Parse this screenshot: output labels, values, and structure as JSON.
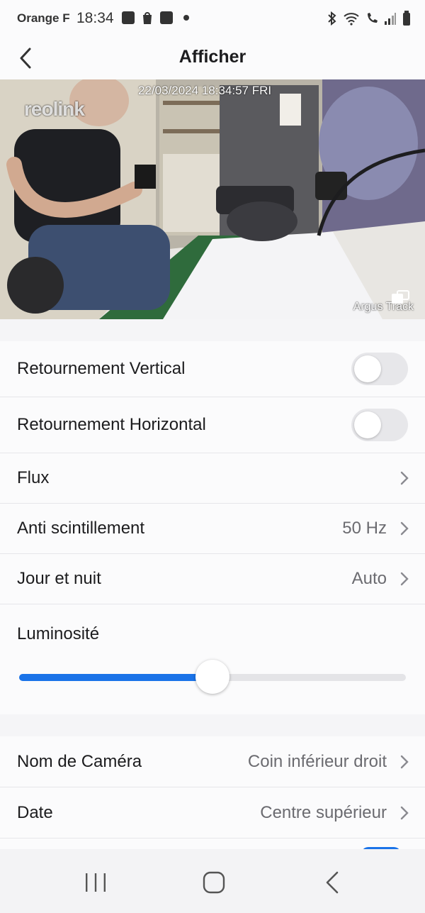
{
  "status_bar": {
    "carrier": "Orange F",
    "time": "18:34"
  },
  "header": {
    "title": "Afficher"
  },
  "preview": {
    "timestamp": "22/03/2024 18:34:57 FRI",
    "logo_text": "reolink",
    "camera_name": "Argus Track"
  },
  "settings": {
    "vertical_flip": {
      "label": "Retournement Vertical",
      "enabled": false
    },
    "horizontal_flip": {
      "label": "Retournement Horizontal",
      "enabled": false
    },
    "stream": {
      "label": "Flux"
    },
    "anti_flicker": {
      "label": "Anti scintillement",
      "value": "50 Hz"
    },
    "day_night": {
      "label": "Jour et nuit",
      "value": "Auto"
    },
    "brightness": {
      "label": "Luminosité",
      "level": 0.5
    }
  },
  "osd": {
    "camera_name": {
      "label": "Nom de Caméra",
      "value": "Coin inférieur droit"
    },
    "date": {
      "label": "Date",
      "value": "Centre supérieur"
    }
  },
  "colors": {
    "accent": "#1a73e8",
    "toggle_off": "#e7e7ea"
  }
}
